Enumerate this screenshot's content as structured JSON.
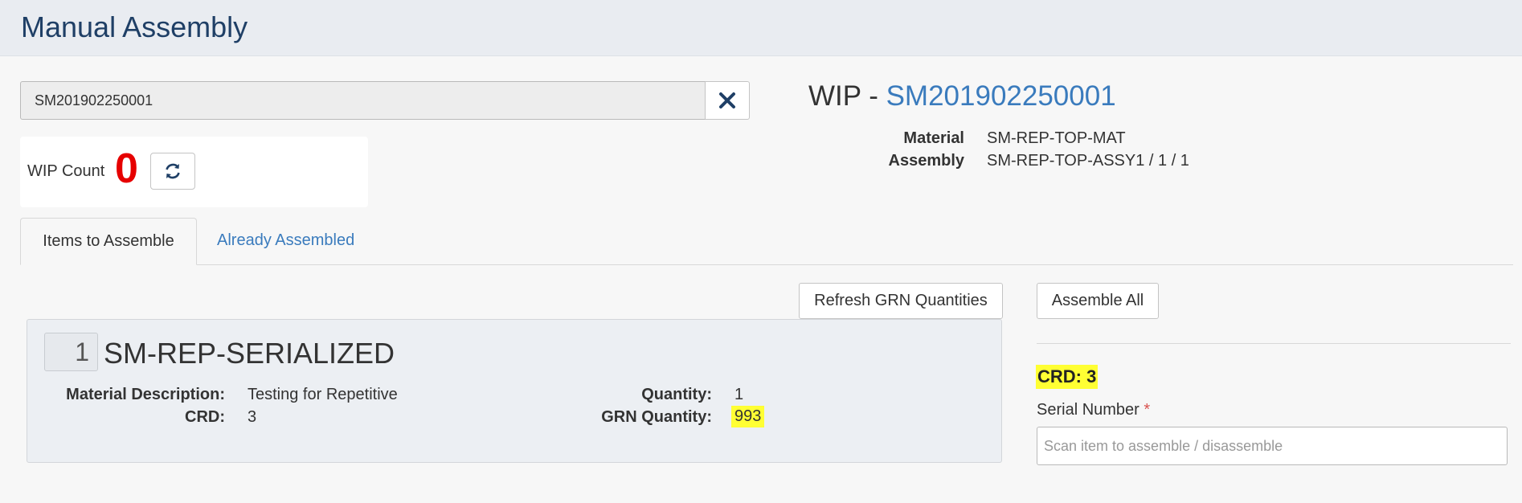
{
  "header": {
    "title": "Manual Assembly"
  },
  "scan": {
    "value": "SM201902250001"
  },
  "wip": {
    "count_label": "WIP Count",
    "count": "0"
  },
  "wip_detail": {
    "prefix": "WIP - ",
    "id": "SM201902250001",
    "material_label": "Material",
    "material_value": "SM-REP-TOP-MAT",
    "assembly_label": "Assembly",
    "assembly_value": "SM-REP-TOP-ASSY1 / 1 / 1"
  },
  "tabs": [
    {
      "label": "Items to Assemble",
      "active": true
    },
    {
      "label": "Already Assembled",
      "active": false
    }
  ],
  "actions": {
    "refresh_grn": "Refresh GRN Quantities",
    "assemble_all": "Assemble All"
  },
  "item": {
    "index": "1",
    "name": "SM-REP-SERIALIZED",
    "material_description_label": "Material Description:",
    "material_description": "Testing for Repetitive",
    "crd_label": "CRD:",
    "crd": "3",
    "quantity_label": "Quantity:",
    "quantity": "1",
    "grn_quantity_label": "GRN Quantity:",
    "grn_quantity": "993"
  },
  "side": {
    "crd_heading": "CRD: 3",
    "serial_label": "Serial Number",
    "serial_required": "*",
    "serial_placeholder": "Scan item to assemble / disassemble"
  },
  "colors": {
    "accent": "#3a7bbd",
    "title": "#1f3f66",
    "count": "#e60000",
    "highlight": "#ffff33"
  },
  "icons": {
    "clear": "close-icon",
    "refresh": "refresh-icon"
  }
}
